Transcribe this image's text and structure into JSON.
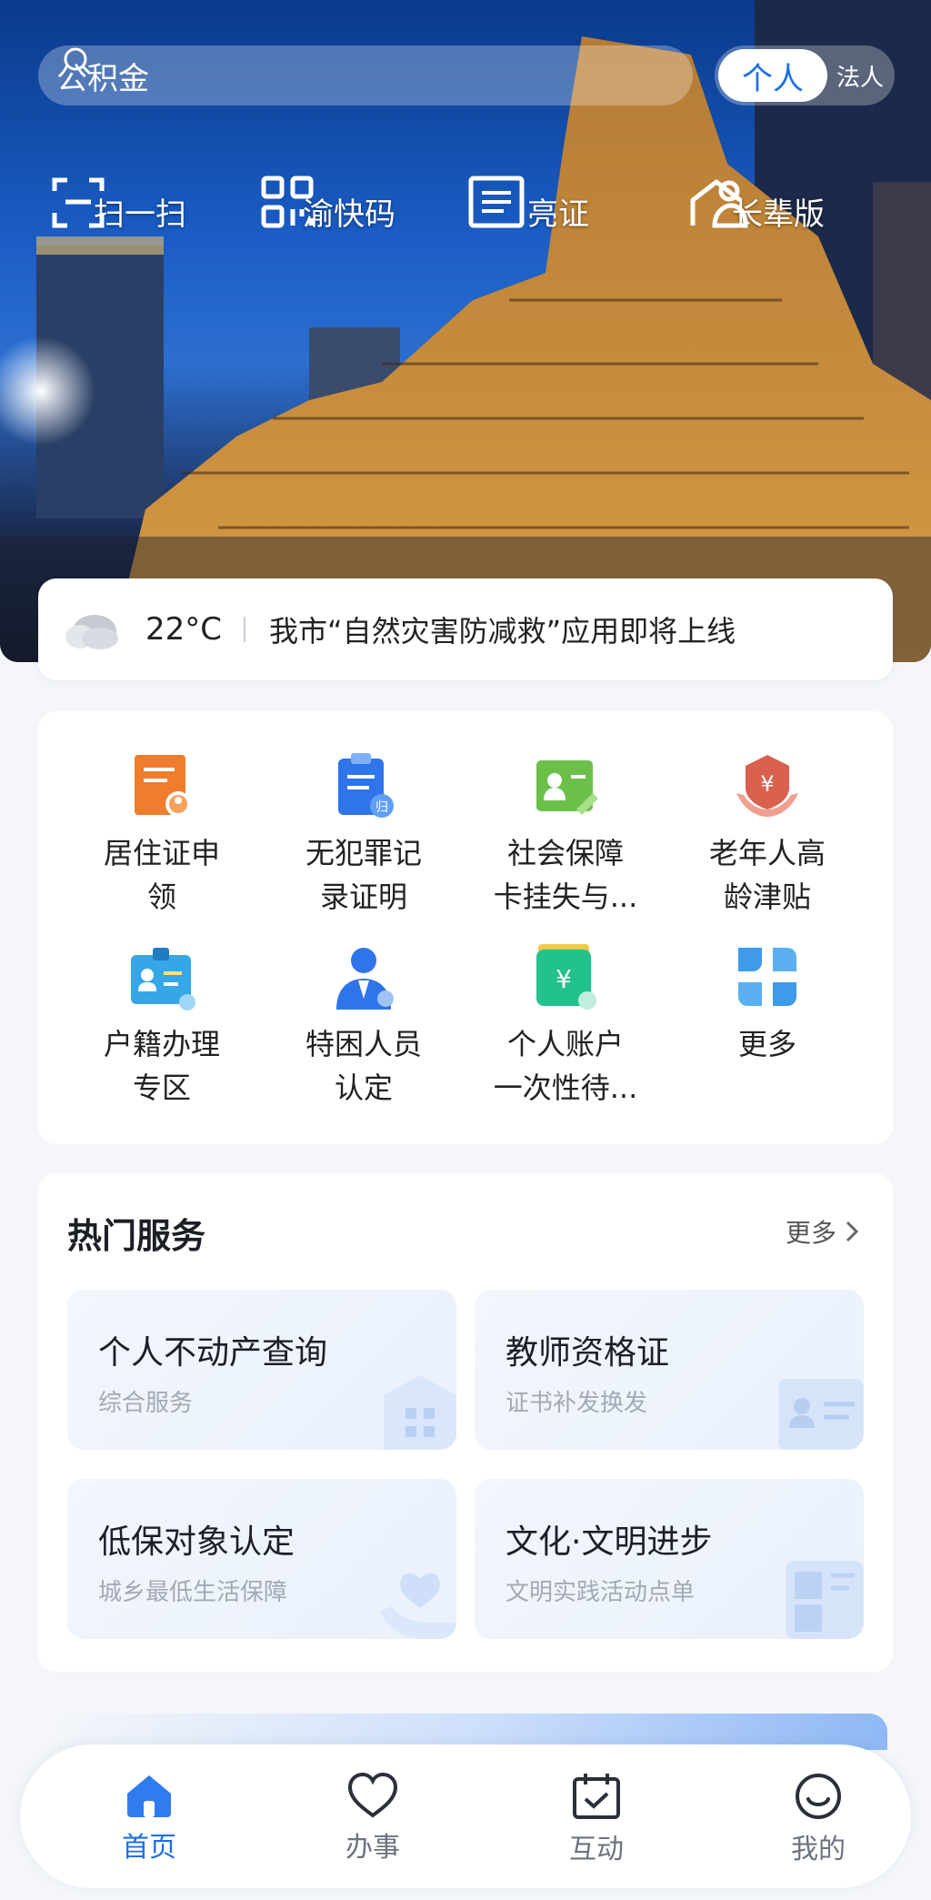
{
  "search": {
    "placeholder": "公积金"
  },
  "identity_toggle": {
    "selected": "个人",
    "other": "法人"
  },
  "quick_actions": [
    {
      "label": "扫一扫",
      "icon": "scan-icon"
    },
    {
      "label": "渝快码",
      "icon": "qr-code-icon"
    },
    {
      "label": "亮证",
      "icon": "id-card-icon"
    },
    {
      "label": "长辈版",
      "icon": "elder-mode-icon"
    }
  ],
  "notice": {
    "weather_icon": "cloud-icon",
    "temperature": "22°C",
    "message": "我市“自然灾害防减救”应用即将上线"
  },
  "services": [
    {
      "line1": "居住证申",
      "line2": "领",
      "icon": "residence-permit-icon",
      "color": "#f07c2c"
    },
    {
      "line1": "无犯罪记",
      "line2": "录证明",
      "icon": "no-crime-record-icon",
      "color": "#2f74e8"
    },
    {
      "line1": "社会保障",
      "line2": "卡挂失与...",
      "icon": "social-security-card-icon",
      "color": "#6cc04a"
    },
    {
      "line1": "老年人高",
      "line2": "龄津贴",
      "icon": "elderly-allowance-icon",
      "color": "#d9614e"
    },
    {
      "line1": "户籍办理",
      "line2": "专区",
      "icon": "household-registration-icon",
      "color": "#35a6e6"
    },
    {
      "line1": "特困人员",
      "line2": "认定",
      "icon": "poverty-person-icon",
      "color": "#2f74e8"
    },
    {
      "line1": "个人账户",
      "line2": "一次性待...",
      "icon": "personal-account-icon",
      "color": "#22c28a"
    },
    {
      "line1": "更多",
      "line2": "",
      "icon": "more-grid-icon",
      "color": "#3d9be8"
    }
  ],
  "hot": {
    "title": "热门服务",
    "more": "更多",
    "items": [
      {
        "title": "个人不动产查询",
        "subtitle": "综合服务",
        "icon": "building-icon"
      },
      {
        "title": "教师资格证",
        "subtitle": "证书补发换发",
        "icon": "certificate-icon"
      },
      {
        "title": "低保对象认定",
        "subtitle": "城乡最低生活保障",
        "icon": "care-hand-icon"
      },
      {
        "title": "文化·文明进步",
        "subtitle": "文明实践活动点单",
        "icon": "culture-icon"
      }
    ]
  },
  "tabbar": [
    {
      "label": "首页",
      "icon": "home-icon",
      "active": true
    },
    {
      "label": "办事",
      "icon": "heart-icon",
      "active": false
    },
    {
      "label": "互动",
      "icon": "calendar-check-icon",
      "active": false
    },
    {
      "label": "我的",
      "icon": "smile-icon",
      "active": false
    }
  ],
  "colors": {
    "accent": "#1e6fe8"
  }
}
